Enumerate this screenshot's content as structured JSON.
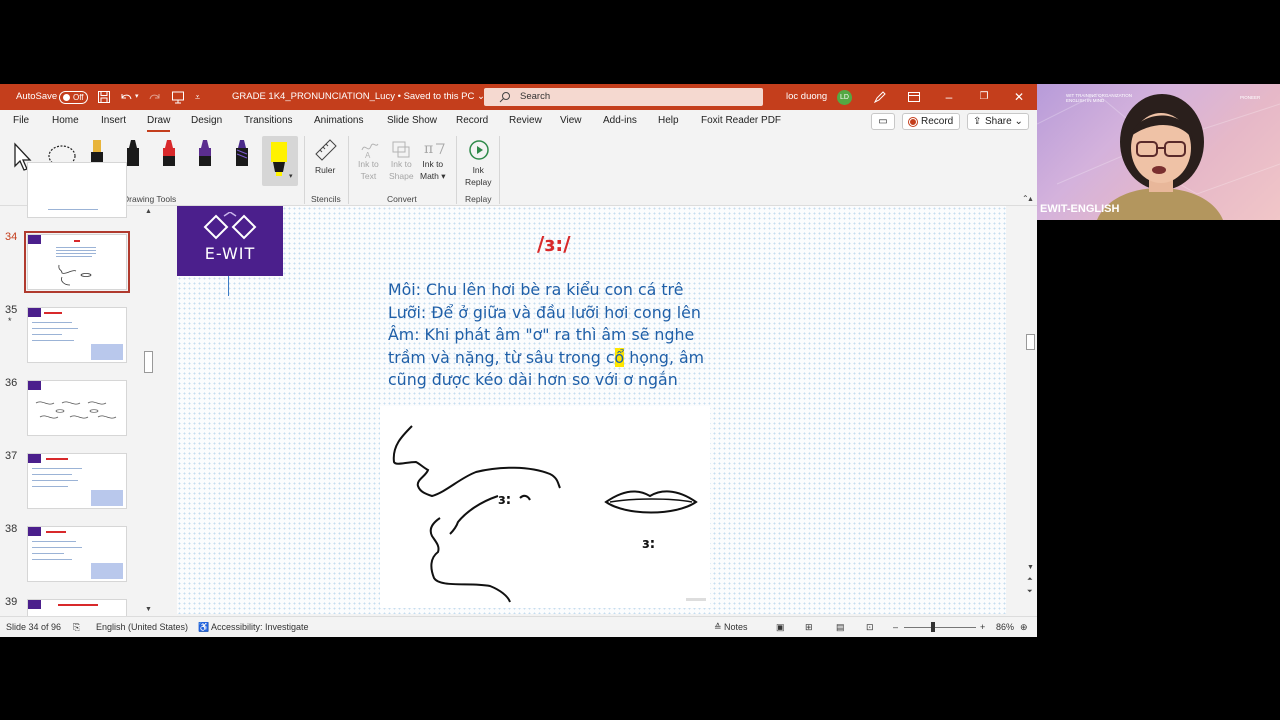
{
  "titlebar": {
    "autosave_label": "AutoSave",
    "autosave_state": "Off",
    "document_title": "GRADE 1K4_PRONUNCIATION_Lucy",
    "save_status": "Saved to this PC",
    "search_placeholder": "Search",
    "user_name": "loc duong",
    "user_initials": "LD"
  },
  "menu": {
    "tabs": [
      "File",
      "Home",
      "Insert",
      "Draw",
      "Design",
      "Transitions",
      "Animations",
      "Slide Show",
      "Record",
      "Review",
      "View",
      "Add-ins",
      "Help",
      "Foxit Reader PDF"
    ],
    "active_tab": "Draw",
    "record_button": "Record",
    "share_button": "Share"
  },
  "ribbon": {
    "groups": {
      "drawing_tools": "Drawing Tools",
      "stencils": "Stencils",
      "convert": "Convert",
      "replay": "Replay"
    },
    "ruler": "Ruler",
    "ink_to_text_1": "Ink to",
    "ink_to_text_2": "Text",
    "ink_to_shape_1": "Ink to",
    "ink_to_shape_2": "Shape",
    "ink_to_math_1": "Ink to",
    "ink_to_math_2": "Math",
    "ink_replay_1": "Ink",
    "ink_replay_2": "Replay",
    "pen_colors": [
      "#1a1a1a",
      "#1a1a1a",
      "#d8292b",
      "#5b2d8e",
      "#4b2a8a",
      "#fff200"
    ]
  },
  "thumbnails": [
    {
      "number": "34",
      "active": true,
      "star": ""
    },
    {
      "number": "35",
      "active": false,
      "star": "*"
    },
    {
      "number": "36",
      "active": false,
      "star": ""
    },
    {
      "number": "37",
      "active": false,
      "star": ""
    },
    {
      "number": "38",
      "active": false,
      "star": ""
    },
    {
      "number": "39",
      "active": false,
      "star": ""
    }
  ],
  "slide": {
    "logo_text": "E-WIT",
    "phoneme": "/ɜ:/",
    "line1": "Môi: Chu lên hơi bè ra kiểu con cá trê",
    "line2": "Lưỡi: Để ở giữa và đầu lưỡi hơi cong lên",
    "line3a": "Âm: Khi phát âm \"ơ\" ra thì âm sẽ nghe",
    "line4a": "trầm và nặng, từ sâu trong c",
    "line4hl": "ổ",
    "line4b": " họng, âm",
    "line5": "cũng được kéo dài hơn so với ơ ngắn",
    "diagram_label_mouth": "ɜ:",
    "diagram_label_lips": "ɜ:"
  },
  "status": {
    "slide_position": "Slide 34 of 96",
    "language": "English (United States)",
    "accessibility": "Accessibility: Investigate",
    "notes": "Notes",
    "zoom": "86%"
  },
  "webcam": {
    "label": "EWIT-ENGLISH",
    "org_line1": "WIT TRAINING ORGANIZATION",
    "org_line2": "ENGLISH IN MIND",
    "corner_text": "PIONEER"
  }
}
